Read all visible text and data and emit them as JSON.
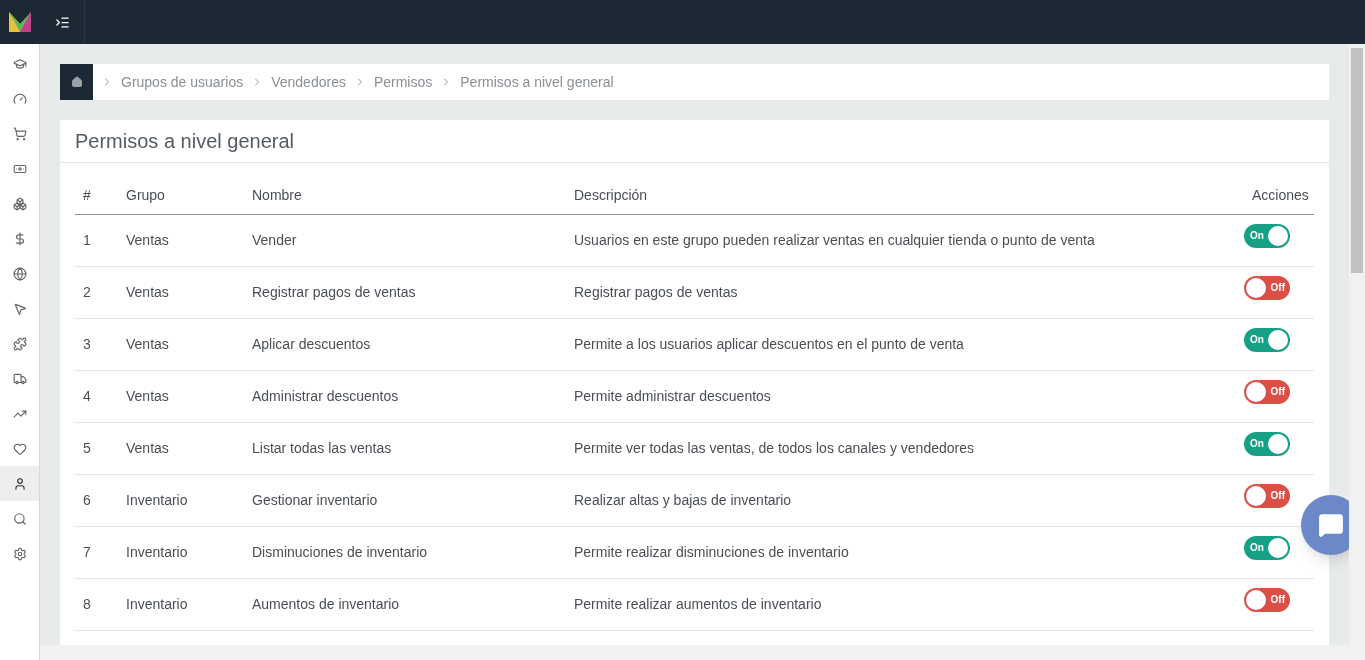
{
  "sidebar": {
    "items": [
      {
        "selected": false
      },
      {
        "selected": false
      },
      {
        "selected": false
      },
      {
        "selected": false
      },
      {
        "selected": false
      },
      {
        "selected": false
      },
      {
        "selected": false
      },
      {
        "selected": false
      },
      {
        "selected": false
      },
      {
        "selected": false
      },
      {
        "selected": false
      },
      {
        "selected": false
      },
      {
        "selected": true
      },
      {
        "selected": false
      },
      {
        "selected": false
      }
    ]
  },
  "breadcrumb": [
    "Grupos de usuarios",
    "Vendedores",
    "Permisos",
    "Permisos a nivel general"
  ],
  "panel": {
    "title": "Permisos a nivel general"
  },
  "table": {
    "columns": [
      "#",
      "Grupo",
      "Nombre",
      "Descripción",
      "Acciones"
    ],
    "rows": [
      {
        "num": "1",
        "group": "Ventas",
        "name": "Vender",
        "description": "Usuarios en este grupo pueden realizar ventas en cualquier tienda o punto de venta",
        "on": true,
        "label": "On"
      },
      {
        "num": "2",
        "group": "Ventas",
        "name": "Registrar pagos de ventas",
        "description": "Registrar pagos de ventas",
        "on": false,
        "label": "Off"
      },
      {
        "num": "3",
        "group": "Ventas",
        "name": "Aplicar descuentos",
        "description": "Permite a los usuarios aplicar descuentos en el punto de venta",
        "on": true,
        "label": "On"
      },
      {
        "num": "4",
        "group": "Ventas",
        "name": "Administrar descuentos",
        "description": "Permite administrar descuentos",
        "on": false,
        "label": "Off"
      },
      {
        "num": "5",
        "group": "Ventas",
        "name": "Listar todas las ventas",
        "description": "Permite ver todas las ventas, de todos los canales y vendedores",
        "on": true,
        "label": "On"
      },
      {
        "num": "6",
        "group": "Inventario",
        "name": "Gestionar inventario",
        "description": "Realizar altas y bajas de inventario",
        "on": false,
        "label": "Off"
      },
      {
        "num": "7",
        "group": "Inventario",
        "name": "Disminuciones de inventario",
        "description": "Permite realizar disminuciones de inventario",
        "on": true,
        "label": "On"
      },
      {
        "num": "8",
        "group": "Inventario",
        "name": "Aumentos de inventario",
        "description": "Permite realizar aumentos de inventario",
        "on": false,
        "label": "Off"
      }
    ]
  }
}
